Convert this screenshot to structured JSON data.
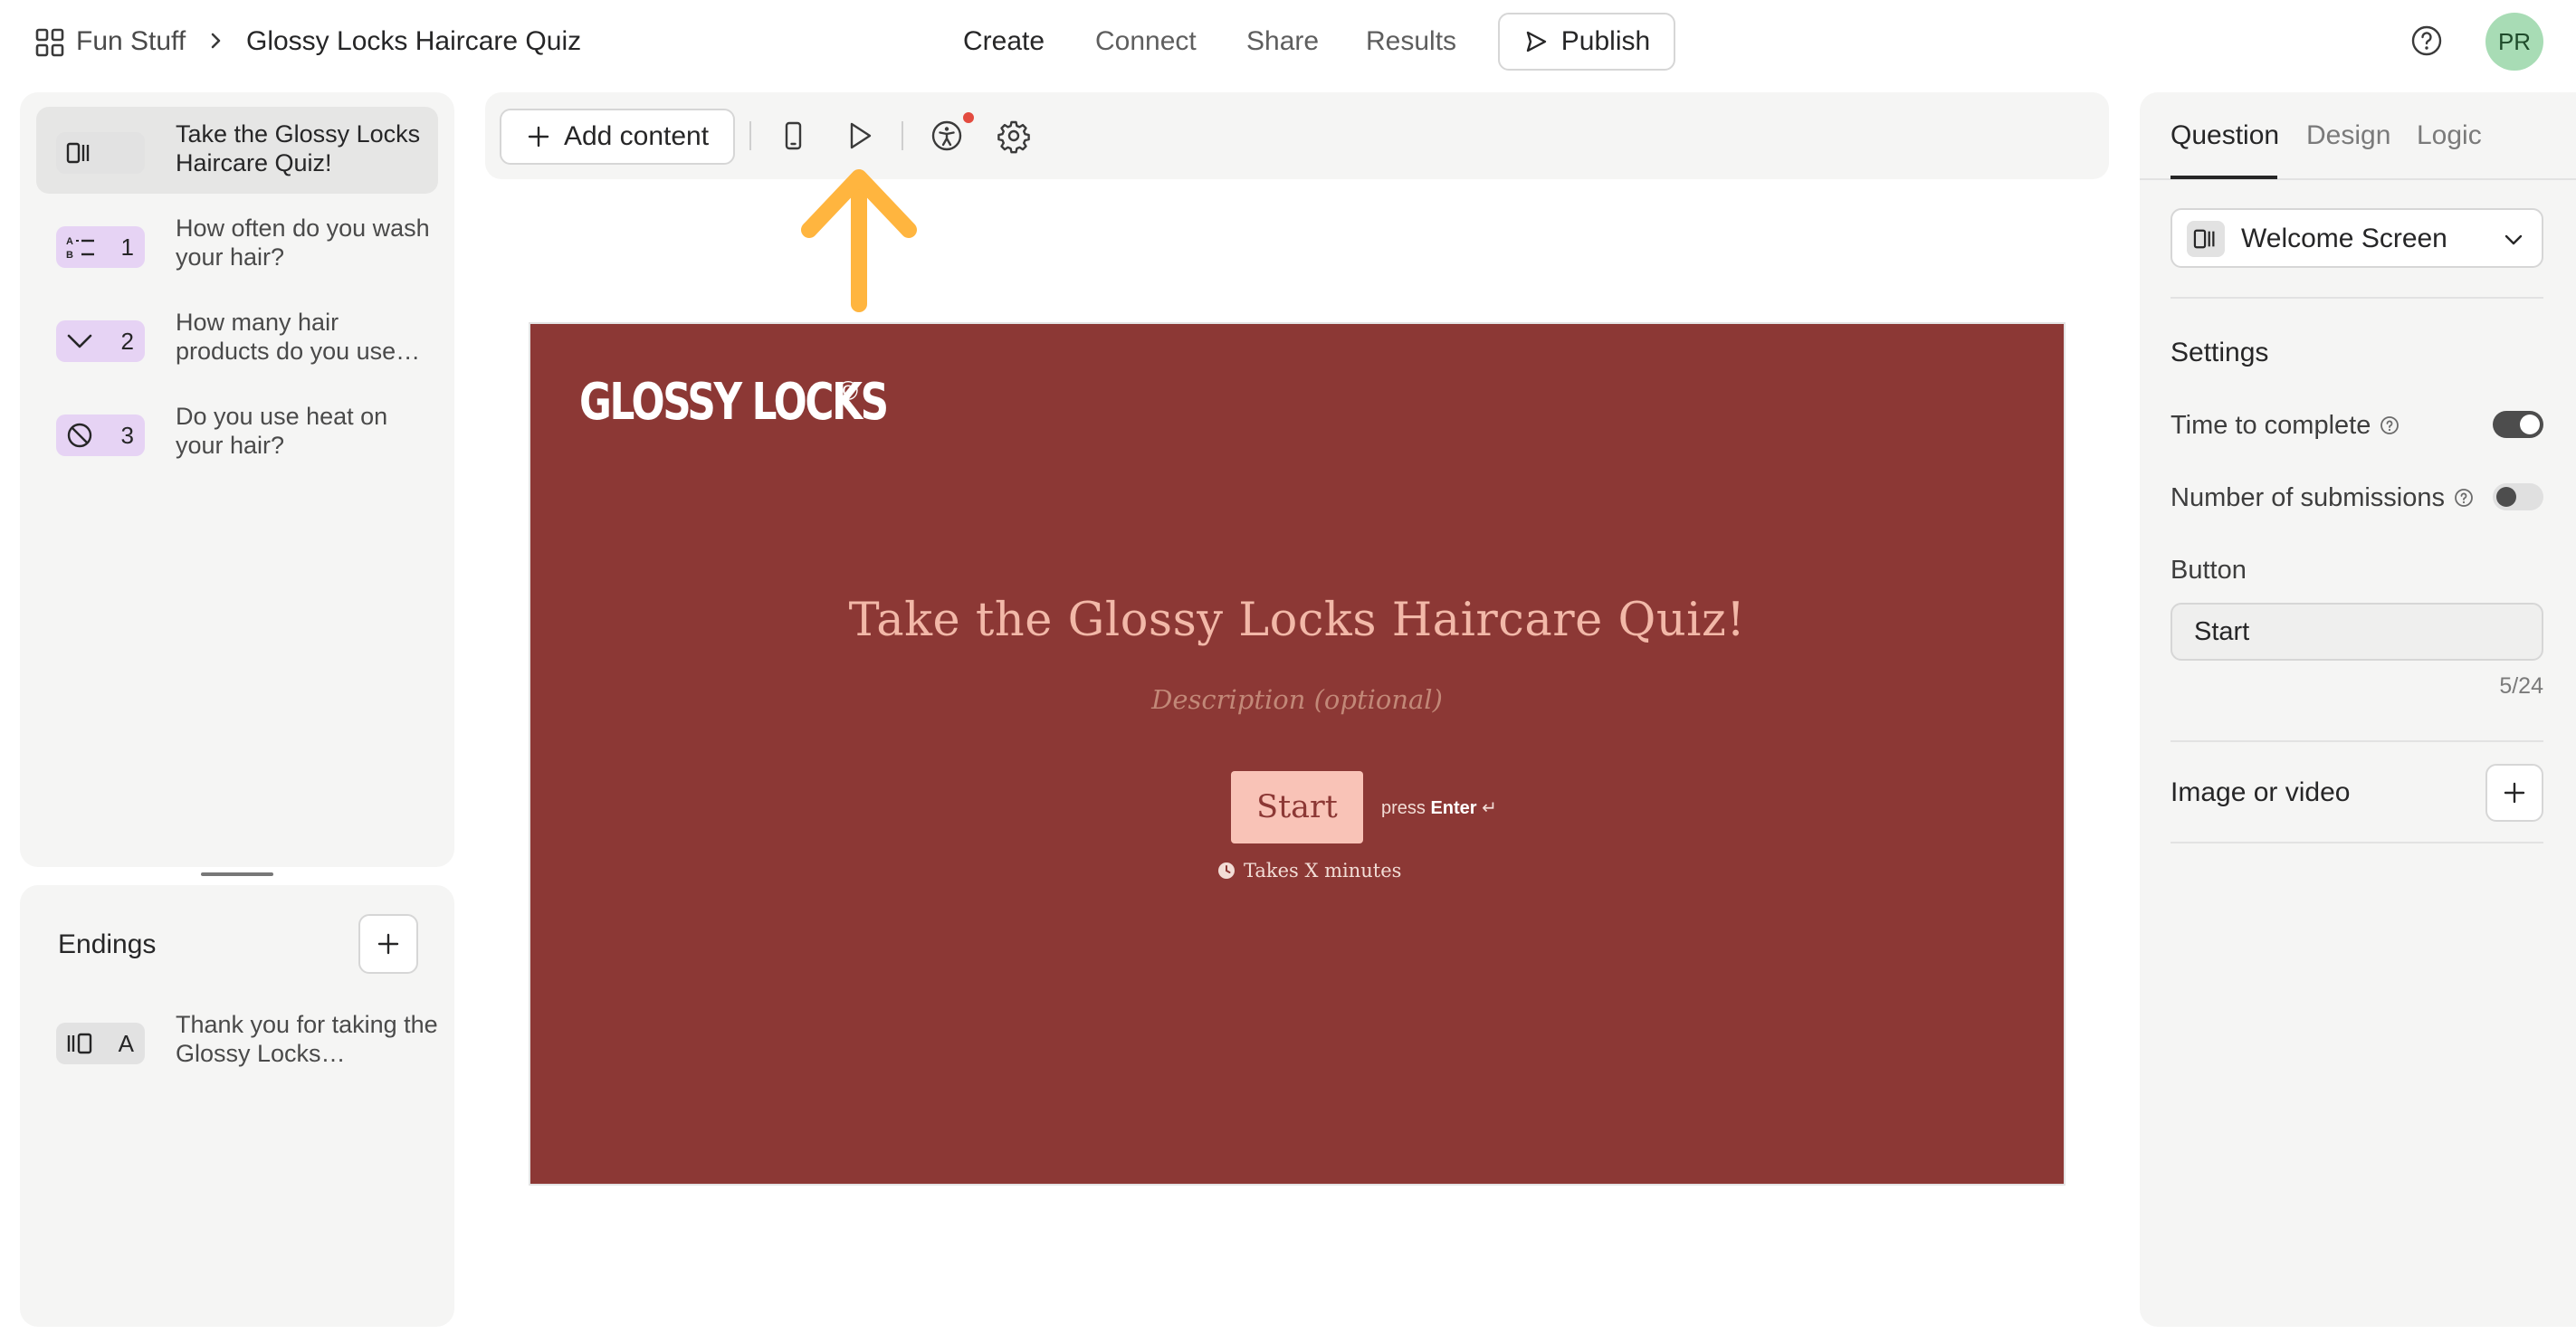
{
  "header": {
    "workspace": "Fun Stuff",
    "form_title": "Glossy Locks Haircare Quiz",
    "nav": [
      "Create",
      "Connect",
      "Share",
      "Results"
    ],
    "publish_label": "Publish",
    "user_initials": "PR"
  },
  "sidebar": {
    "questions": [
      {
        "number": "",
        "text": "Take the Glossy Locks Haircare Quiz!",
        "icon": "welcome-screen-icon",
        "badge_color": "#e2e2e2",
        "active": true
      },
      {
        "number": "1",
        "text": "How often do you wash your hair?",
        "icon": "multiple-choice-icon",
        "badge_color": "#e6d3f4",
        "active": false
      },
      {
        "number": "2",
        "text": "How many hair products do you use…",
        "icon": "dropdown-icon",
        "badge_color": "#e6d3f4",
        "active": false
      },
      {
        "number": "3",
        "text": "Do you use heat on your hair?",
        "icon": "yes-no-icon",
        "badge_color": "#e6d3f4",
        "active": false
      }
    ],
    "endings": {
      "title": "Endings",
      "items": [
        {
          "letter": "A",
          "text": "Thank you for taking the Glossy Locks…",
          "icon": "ending-screen-icon"
        }
      ]
    }
  },
  "toolbar": {
    "add_content_label": "Add content",
    "icons": [
      "mobile-preview-icon",
      "play-preview-icon",
      "accessibility-icon",
      "settings-gear-icon"
    ]
  },
  "canvas": {
    "background_color": "#8c3835",
    "logo_text": "GLOSSY LOCKS",
    "logo_mark": "©",
    "title": "Take the Glossy Locks Haircare Quiz!",
    "description_placeholder": "Description (optional)",
    "start_label": "Start",
    "press_hint_prefix": "press",
    "press_hint_key": "Enter",
    "press_hint_symbol": "↵",
    "takes_time": "Takes X minutes"
  },
  "right_panel": {
    "tabs": [
      "Question",
      "Design",
      "Logic"
    ],
    "active_tab": "Question",
    "question_type": "Welcome Screen",
    "settings_heading": "Settings",
    "time_to_complete_label": "Time to complete",
    "time_to_complete_on": true,
    "submissions_label": "Number of submissions",
    "submissions_on": false,
    "button_label": "Button",
    "button_value": "Start",
    "char_count": "5/24",
    "media_label": "Image or video"
  },
  "colors": {
    "accent_annotation": "#ffb53f",
    "avatar_bg": "#a8dcb5",
    "notification_dot": "#e34b3f"
  }
}
